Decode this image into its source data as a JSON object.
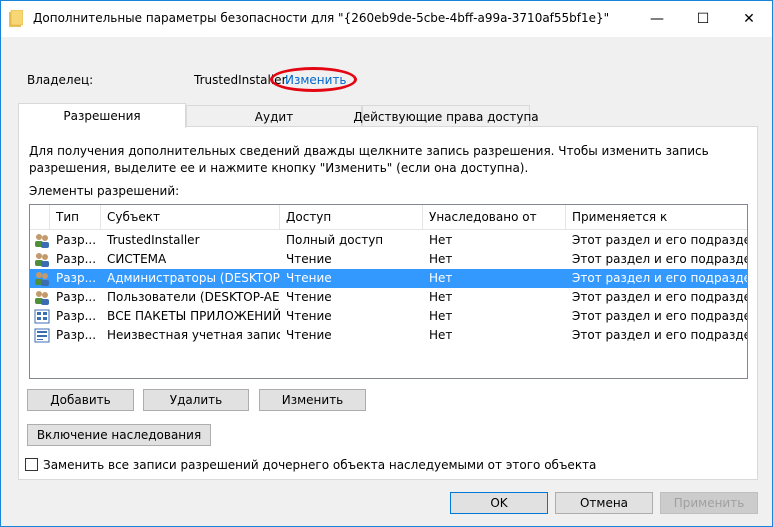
{
  "window": {
    "title": "Дополнительные параметры безопасности  для \"{260eb9de-5cbe-4bff-a99a-3710af55bf1e}\"",
    "minimize_glyph": "—",
    "maximize_glyph": "☐",
    "close_glyph": "✕"
  },
  "owner": {
    "label": "Владелец:",
    "value": "TrustedInstaller",
    "change_link": "Изменить",
    "highlight_color": "#e30613"
  },
  "tabs": [
    {
      "label": "Разрешения",
      "active": true
    },
    {
      "label": "Аудит",
      "active": false
    },
    {
      "label": "Действующие права доступа",
      "active": false
    }
  ],
  "panel": {
    "hint": "Для получения дополнительных сведений дважды щелкните запись разрешения. Чтобы изменить запись разрешения, выделите ее и нажмите кнопку \"Изменить\" (если она доступна).",
    "list_caption": "Элементы разрешений:"
  },
  "list": {
    "columns": [
      "Тип",
      "Субъект",
      "Доступ",
      "Унаследовано от",
      "Применяется к"
    ],
    "rows": [
      {
        "icon": "users-icon",
        "type": "Разр...",
        "subject": "TrustedInstaller",
        "access": "Полный доступ",
        "inherited": "Нет",
        "applies": "Этот раздел и его подразделы",
        "selected": false
      },
      {
        "icon": "users-icon",
        "type": "Разр...",
        "subject": "СИСТЕМА",
        "access": "Чтение",
        "inherited": "Нет",
        "applies": "Этот раздел и его подразделы",
        "selected": false
      },
      {
        "icon": "users-icon",
        "type": "Разр...",
        "subject": "Администраторы (DESKTOP-...",
        "access": "Чтение",
        "inherited": "Нет",
        "applies": "Этот раздел и его подразделы",
        "selected": true
      },
      {
        "icon": "users-icon",
        "type": "Разр...",
        "subject": "Пользователи (DESKTOP-AE...",
        "access": "Чтение",
        "inherited": "Нет",
        "applies": "Этот раздел и его подразделы",
        "selected": false
      },
      {
        "icon": "app-packages-icon",
        "type": "Разр...",
        "subject": "ВСЕ ПАКЕТЫ ПРИЛОЖЕНИЙ",
        "access": "Чтение",
        "inherited": "Нет",
        "applies": "Этот раздел и его подразделы",
        "selected": false
      },
      {
        "icon": "unknown-account-icon",
        "type": "Разр...",
        "subject": "Неизвестная учетная запись...",
        "access": "Чтение",
        "inherited": "Нет",
        "applies": "Этот раздел и его подразделы",
        "selected": false
      }
    ]
  },
  "buttons": {
    "add": "Добавить",
    "remove": "Удалить",
    "edit": "Изменить",
    "inheritance": "Включение наследования",
    "ok": "OK",
    "cancel": "Отмена",
    "apply": "Применить"
  },
  "replace_checkbox": {
    "label": "Заменить все записи разрешений дочернего объекта наследуемыми от этого объекта",
    "checked": false
  },
  "colors": {
    "accent": "#0078d7",
    "selection": "#3399ff"
  }
}
